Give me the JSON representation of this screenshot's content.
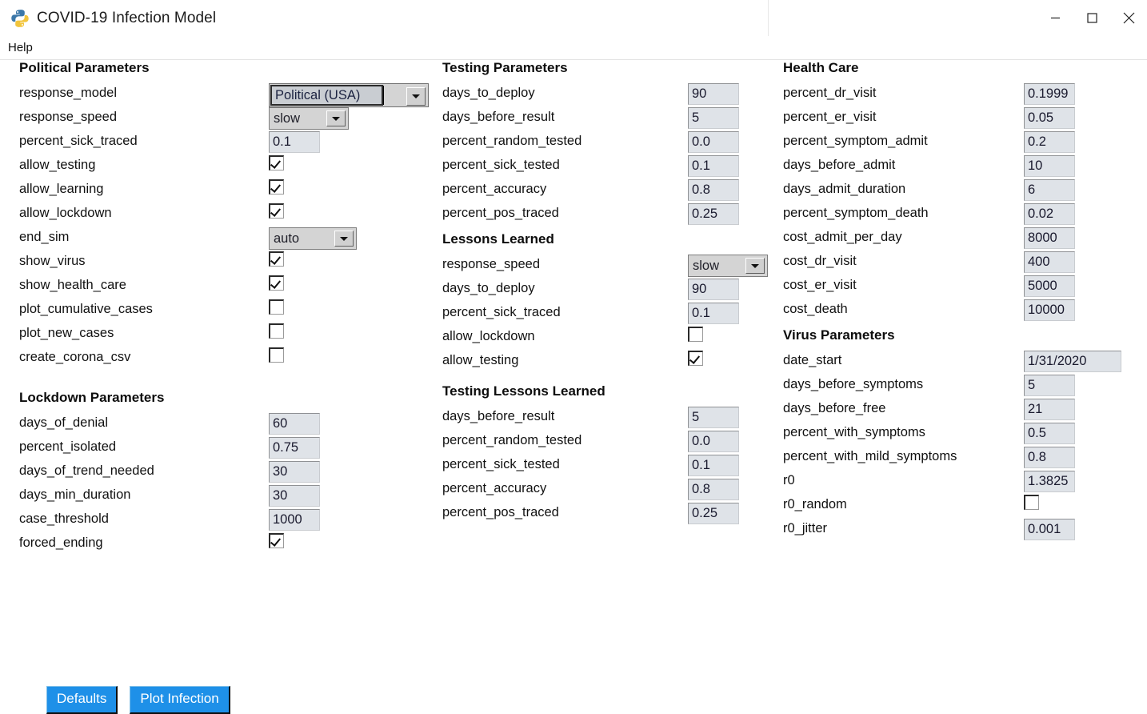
{
  "window": {
    "title": "COVID-19 Infection Model",
    "logo_icon": "python-logo-icon",
    "minimize_icon": "minimize-icon",
    "maximize_icon": "maximize-icon",
    "close_icon": "close-icon"
  },
  "menubar": {
    "items": [
      {
        "label": "Help"
      }
    ]
  },
  "accent_color": "#1e90e8",
  "sections": {
    "political": {
      "title": "Political Parameters",
      "rows": [
        {
          "label": "response_model",
          "type": "combo-focus",
          "value": "Political (USA)"
        },
        {
          "label": "response_speed",
          "type": "combo",
          "value": "slow"
        },
        {
          "label": "percent_sick_traced",
          "type": "entry",
          "value": "0.1"
        },
        {
          "label": "allow_testing",
          "type": "checkbox",
          "value": true
        },
        {
          "label": "allow_learning",
          "type": "checkbox",
          "value": true
        },
        {
          "label": "allow_lockdown",
          "type": "checkbox",
          "value": true
        },
        {
          "label": "end_sim",
          "type": "combo",
          "value": "auto"
        },
        {
          "label": "show_virus",
          "type": "checkbox",
          "value": true
        },
        {
          "label": "show_health_care",
          "type": "checkbox",
          "value": true
        },
        {
          "label": "plot_cumulative_cases",
          "type": "checkbox",
          "value": false
        },
        {
          "label": "plot_new_cases",
          "type": "checkbox",
          "value": false
        },
        {
          "label": "create_corona_csv",
          "type": "checkbox",
          "value": false
        }
      ]
    },
    "lockdown": {
      "title": "Lockdown Parameters",
      "rows": [
        {
          "label": "days_of_denial",
          "type": "entry",
          "value": "60"
        },
        {
          "label": "percent_isolated",
          "type": "entry",
          "value": "0.75"
        },
        {
          "label": "days_of_trend_needed",
          "type": "entry",
          "value": "30"
        },
        {
          "label": "days_min_duration",
          "type": "entry",
          "value": "30"
        },
        {
          "label": "case_threshold",
          "type": "entry",
          "value": "1000"
        },
        {
          "label": "forced_ending",
          "type": "checkbox",
          "value": true
        }
      ]
    },
    "testing": {
      "title": "Testing Parameters",
      "rows": [
        {
          "label": "days_to_deploy",
          "type": "entry",
          "value": "90"
        },
        {
          "label": "days_before_result",
          "type": "entry",
          "value": "5"
        },
        {
          "label": "percent_random_tested",
          "type": "entry",
          "value": "0.0"
        },
        {
          "label": "percent_sick_tested",
          "type": "entry",
          "value": "0.1"
        },
        {
          "label": "percent_accuracy",
          "type": "entry",
          "value": "0.8"
        },
        {
          "label": "percent_pos_traced",
          "type": "entry",
          "value": "0.25"
        }
      ]
    },
    "lessons_learned": {
      "title": "Lessons Learned",
      "rows": [
        {
          "label": "response_speed",
          "type": "combo",
          "value": "slow"
        },
        {
          "label": "days_to_deploy",
          "type": "entry",
          "value": "90"
        },
        {
          "label": "percent_sick_traced",
          "type": "entry",
          "value": "0.1"
        },
        {
          "label": "allow_lockdown",
          "type": "checkbox",
          "value": false
        },
        {
          "label": "allow_testing",
          "type": "checkbox",
          "value": true
        }
      ]
    },
    "testing_lessons_learned": {
      "title": "Testing Lessons Learned",
      "rows": [
        {
          "label": "days_before_result",
          "type": "entry",
          "value": "5"
        },
        {
          "label": "percent_random_tested",
          "type": "entry",
          "value": "0.0"
        },
        {
          "label": "percent_sick_tested",
          "type": "entry",
          "value": "0.1"
        },
        {
          "label": "percent_accuracy",
          "type": "entry",
          "value": "0.8"
        },
        {
          "label": "percent_pos_traced",
          "type": "entry",
          "value": "0.25"
        }
      ]
    },
    "health_care": {
      "title": "Health Care",
      "rows": [
        {
          "label": "percent_dr_visit",
          "type": "entry",
          "value": "0.1999"
        },
        {
          "label": "percent_er_visit",
          "type": "entry",
          "value": "0.05"
        },
        {
          "label": "percent_symptom_admit",
          "type": "entry",
          "value": "0.2"
        },
        {
          "label": "days_before_admit",
          "type": "entry",
          "value": "10"
        },
        {
          "label": "days_admit_duration",
          "type": "entry",
          "value": "6"
        },
        {
          "label": "percent_symptom_death",
          "type": "entry",
          "value": "0.02"
        },
        {
          "label": "cost_admit_per_day",
          "type": "entry",
          "value": "8000"
        },
        {
          "label": "cost_dr_visit",
          "type": "entry",
          "value": "400"
        },
        {
          "label": "cost_er_visit",
          "type": "entry",
          "value": "5000"
        },
        {
          "label": "cost_death",
          "type": "entry",
          "value": "10000"
        }
      ]
    },
    "virus": {
      "title": "Virus Parameters",
      "rows": [
        {
          "label": "date_start",
          "type": "entry-wide",
          "value": "1/31/2020"
        },
        {
          "label": "days_before_symptoms",
          "type": "entry",
          "value": "5"
        },
        {
          "label": "days_before_free",
          "type": "entry",
          "value": "21"
        },
        {
          "label": "percent_with_symptoms",
          "type": "entry",
          "value": "0.5"
        },
        {
          "label": "percent_with_mild_symptoms",
          "type": "entry",
          "value": "0.8"
        },
        {
          "label": "r0",
          "type": "entry",
          "value": "1.3825"
        },
        {
          "label": "r0_random",
          "type": "checkbox",
          "value": false
        },
        {
          "label": "r0_jitter",
          "type": "entry",
          "value": "0.001"
        }
      ]
    }
  },
  "buttons": [
    {
      "label": "Defaults",
      "name": "defaults-button"
    },
    {
      "label": "Plot Infection",
      "name": "plot-infection-button"
    }
  ]
}
